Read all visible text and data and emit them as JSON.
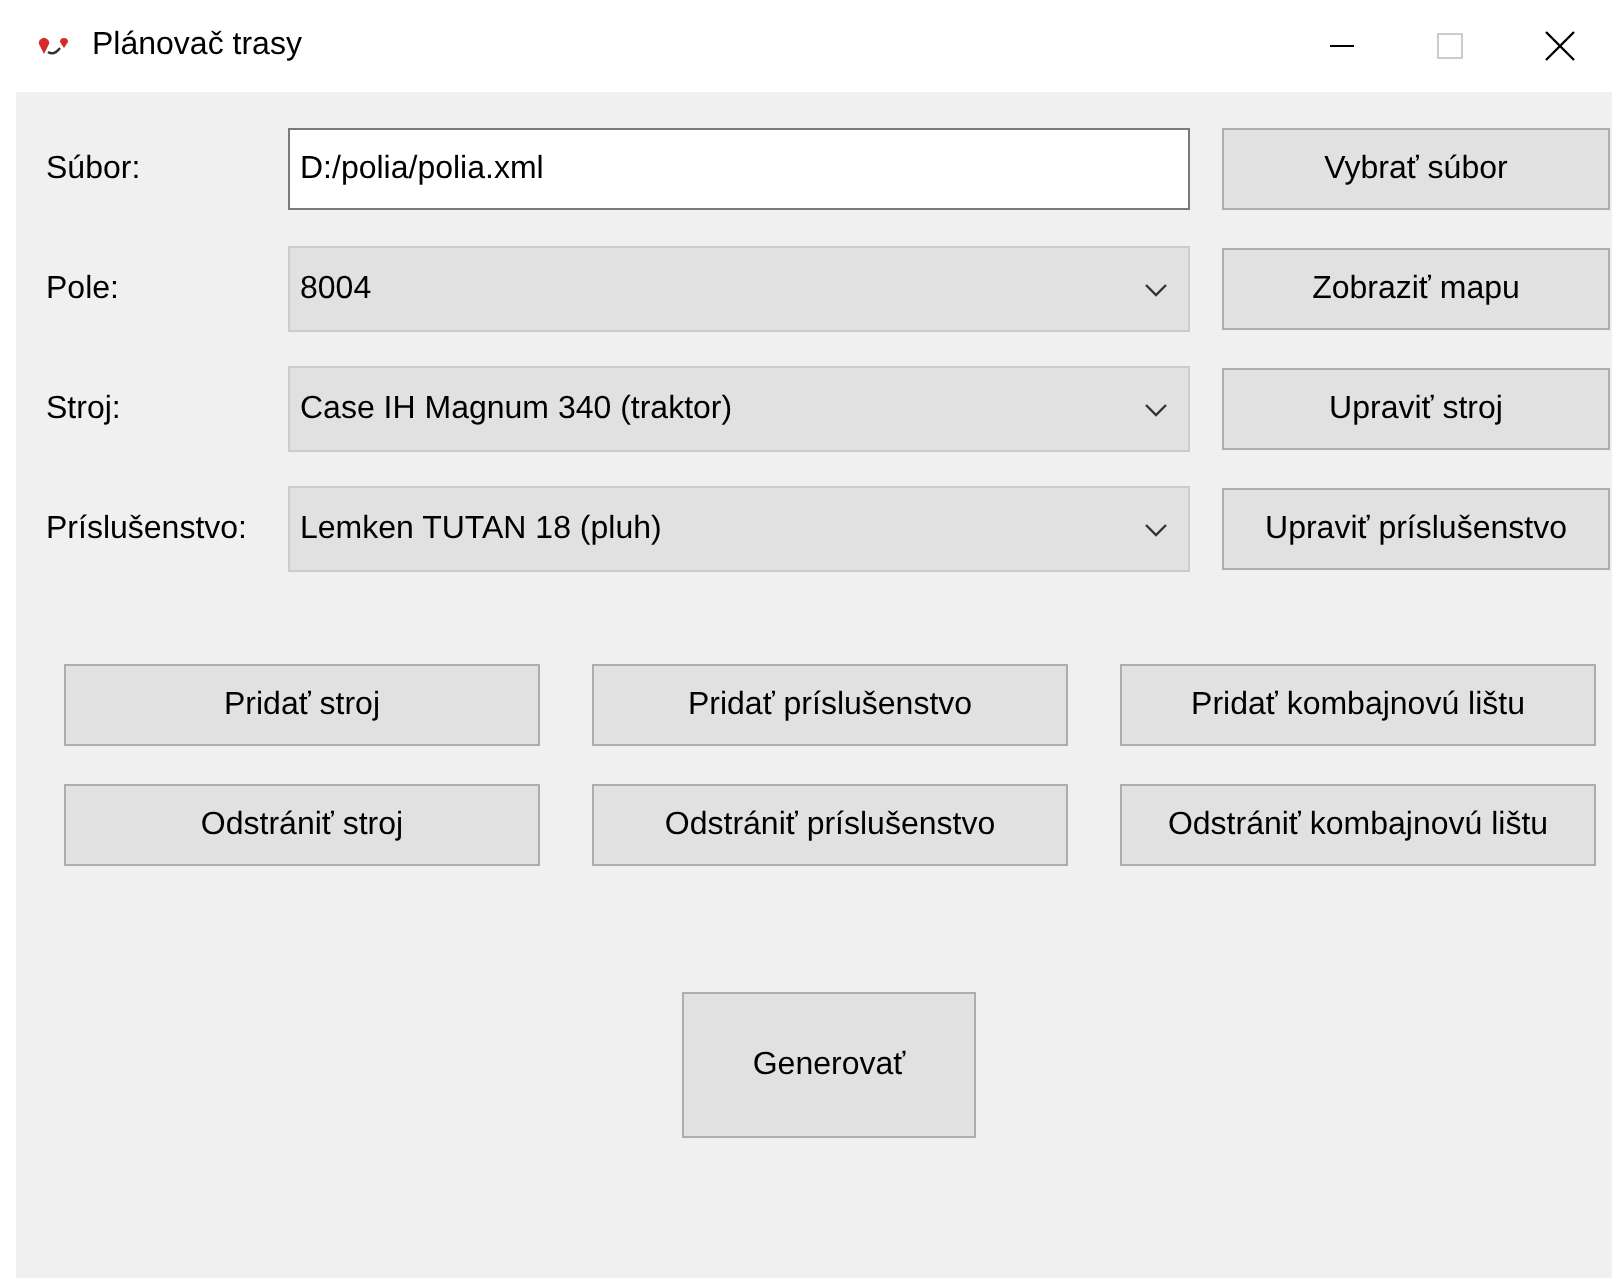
{
  "window": {
    "title": "Plánovač trasy",
    "maximize_disabled": true
  },
  "fields": [
    {
      "label": "Súbor:",
      "kind": "text",
      "value": "D:/polia/polia.xml",
      "button": "Vybrať súbor"
    },
    {
      "label": "Pole:",
      "kind": "combo",
      "value": "8004",
      "button": "Zobraziť mapu"
    },
    {
      "label": "Stroj:",
      "kind": "combo",
      "value": "Case IH Magnum 340 (traktor)",
      "button": "Upraviť stroj"
    },
    {
      "label": "Príslušenstvo:",
      "kind": "combo",
      "value": "Lemken TUTAN 18 (pluh)",
      "button": "Upraviť príslušenstvo"
    }
  ],
  "actions": [
    [
      "Pridať stroj",
      "Pridať príslušenstvo",
      "Pridať kombajnovú lištu"
    ],
    [
      "Odstrániť stroj",
      "Odstrániť príslušenstvo",
      "Odstrániť kombajnovú lištu"
    ]
  ],
  "generate": "Generovať"
}
